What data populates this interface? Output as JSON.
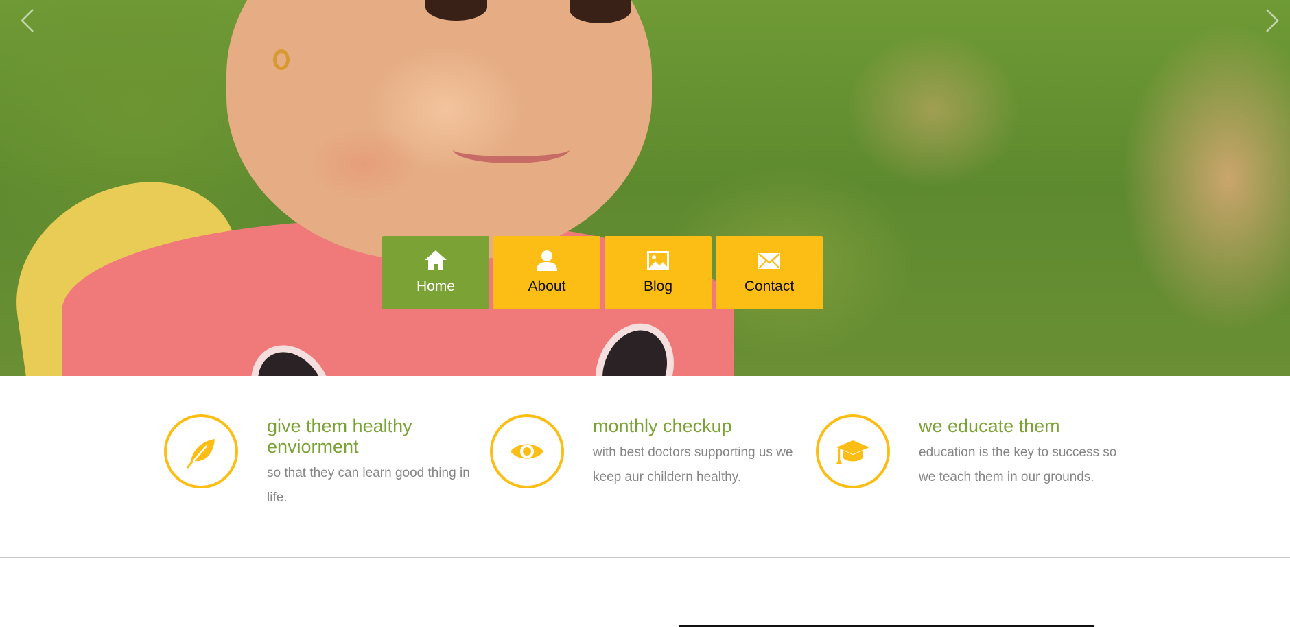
{
  "hero": {
    "prev_icon": "chevron-left-icon",
    "next_icon": "chevron-right-icon"
  },
  "nav": {
    "items": [
      {
        "label": "Home",
        "icon": "home-icon",
        "active": true
      },
      {
        "label": "About",
        "icon": "user-icon",
        "active": false
      },
      {
        "label": "Blog",
        "icon": "image-icon",
        "active": false
      },
      {
        "label": "Contact",
        "icon": "envelope-icon",
        "active": false
      }
    ]
  },
  "features": [
    {
      "icon": "leaf-icon",
      "title": "give them healthy enviorment",
      "desc": "so that they can learn good thing in life."
    },
    {
      "icon": "eye-icon",
      "title": "monthly checkup",
      "desc": "with best doctors supporting us we keep aur childern healthy."
    },
    {
      "icon": "graduation-cap-icon",
      "title": "we educate them",
      "desc": "education is the key to success so we teach them in our grounds."
    }
  ],
  "colors": {
    "accent_green": "#7aa234",
    "accent_yellow": "#fcbd14",
    "body_text": "#858585"
  }
}
